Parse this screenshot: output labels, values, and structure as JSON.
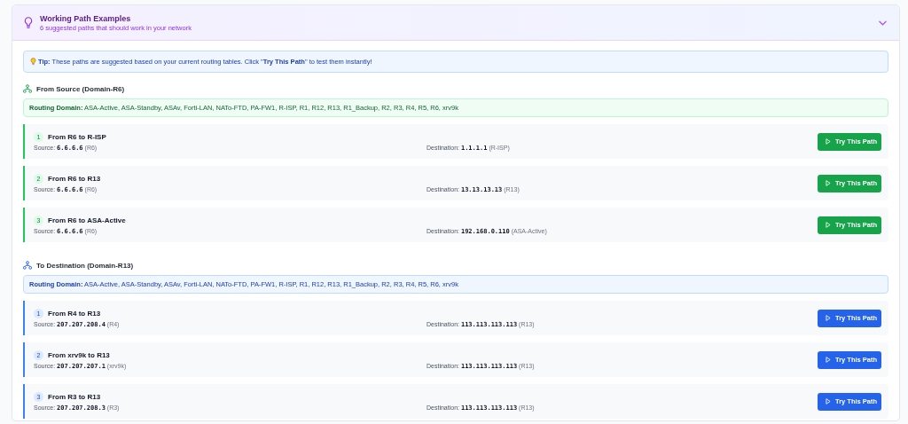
{
  "panel": {
    "title": "Working Path Examples",
    "subtitle": "6 suggested paths that should work in your network",
    "expanded": true
  },
  "tip": "**Tip:** These paths are suggested based on your current routing tables. Click \"**Try This Path**\" to test them instantly!",
  "sections": [
    {
      "kind": "source",
      "heading": "From Source (Domain-R6)",
      "domain_label": "Routing Domain:",
      "domain": "ASA-Active, ASA-Standby, ASAv, Forti-LAN, NATo-FTD, PA-FW1, R-ISP, R1, R12, R13, R1_Backup, R2, R3, R4, R5, R6, xrv9k",
      "paths": [
        {
          "number": "1",
          "title": "From R6 to R-ISP",
          "source_label": "Source:",
          "source_ip": "6.6.6.6",
          "source_name": "(R6)",
          "dest_label": "Destination:",
          "dest_ip": "1.1.1.1",
          "dest_name": "(R-ISP)",
          "button": "Try This Path"
        },
        {
          "number": "2",
          "title": "From R6 to R13",
          "source_label": "Source:",
          "source_ip": "6.6.6.6",
          "source_name": "(R6)",
          "dest_label": "Destination:",
          "dest_ip": "13.13.13.13",
          "dest_name": "(R13)",
          "button": "Try This Path"
        },
        {
          "number": "3",
          "title": "From R6 to ASA-Active",
          "source_label": "Source:",
          "source_ip": "6.6.6.6",
          "source_name": "(R6)",
          "dest_label": "Destination:",
          "dest_ip": "192.168.0.110",
          "dest_name": "(ASA-Active)",
          "button": "Try This Path"
        }
      ]
    },
    {
      "kind": "destination",
      "heading": "To Destination (Domain-R13)",
      "domain_label": "Routing Domain:",
      "domain": "ASA-Active, ASA-Standby, ASAv, Forti-LAN, NATo-FTD, PA-FW1, R-ISP, R1, R12, R13, R1_Backup, R2, R3, R4, R5, R6, xrv9k",
      "paths": [
        {
          "number": "1",
          "title": "From R4 to R13",
          "source_label": "Source:",
          "source_ip": "207.207.208.4",
          "source_name": "(R4)",
          "dest_label": "Destination:",
          "dest_ip": "113.113.113.113",
          "dest_name": "(R13)",
          "button": "Try This Path"
        },
        {
          "number": "2",
          "title": "From xrv9k to R13",
          "source_label": "Source:",
          "source_ip": "207.207.207.1",
          "source_name": "(xrv9k)",
          "dest_label": "Destination:",
          "dest_ip": "113.113.113.113",
          "dest_name": "(R13)",
          "button": "Try This Path"
        },
        {
          "number": "3",
          "title": "From R3 to R13",
          "source_label": "Source:",
          "source_ip": "207.207.208.3",
          "source_name": "(R3)",
          "dest_label": "Destination:",
          "dest_ip": "113.113.113.113",
          "dest_name": "(R13)",
          "button": "Try This Path"
        }
      ]
    }
  ]
}
